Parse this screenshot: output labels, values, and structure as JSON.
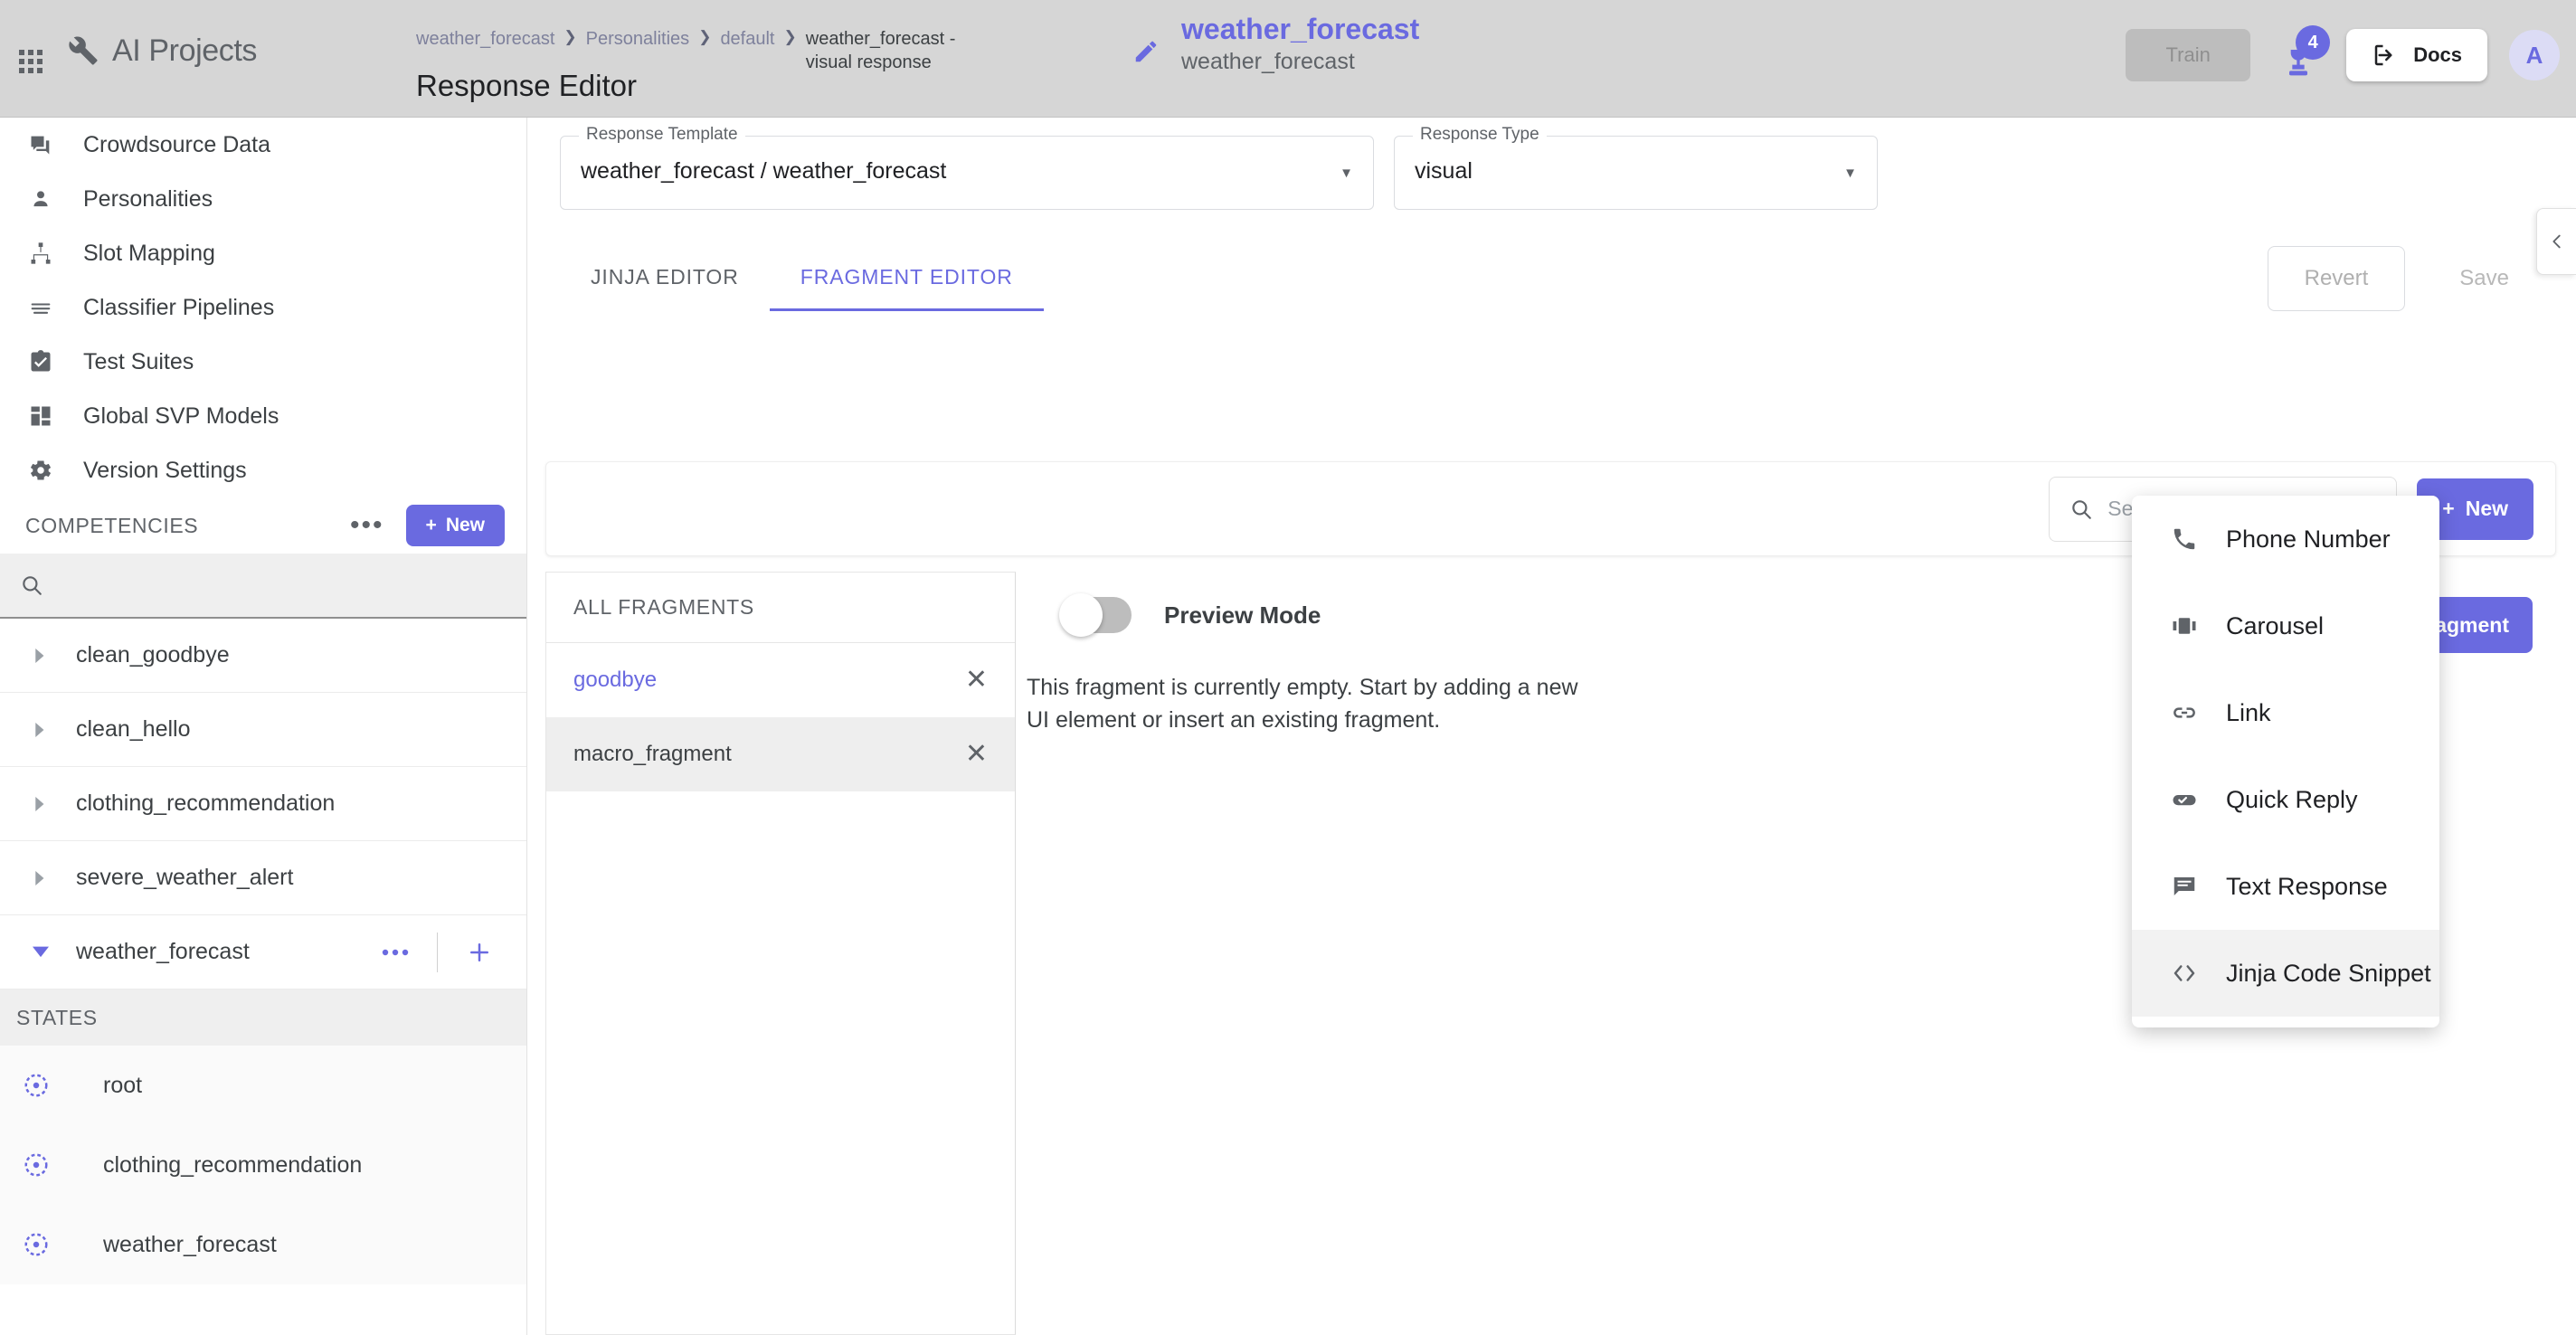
{
  "topbar": {
    "brand": "AI Projects",
    "brand_icon": "wrench-icon",
    "apps_icon": "apps-grid-icon",
    "breadcrumb": [
      "weather_forecast",
      "Personalities",
      "default"
    ],
    "breadcrumb_current": "weather_forecast - visual response",
    "page_title": "Response Editor",
    "entity_title": "weather_forecast",
    "entity_subtitle": "weather_forecast",
    "edit_icon": "pencil-icon",
    "train_label": "Train",
    "model_badge_count": "4",
    "model_icon": "model-trophy-icon",
    "docs_label": "Docs",
    "docs_icon": "export-arrow-icon",
    "avatar_initial": "A"
  },
  "sidebar": {
    "nav": [
      {
        "label": "Crowdsource Data",
        "icon": "forum-icon"
      },
      {
        "label": "Personalities",
        "icon": "person-icon"
      },
      {
        "label": "Slot Mapping",
        "icon": "account-tree-icon"
      },
      {
        "label": "Classifier Pipelines",
        "icon": "lines-icon"
      },
      {
        "label": "Test Suites",
        "icon": "clipboard-check-icon"
      },
      {
        "label": "Global SVP Models",
        "icon": "dashboard-icon"
      },
      {
        "label": "Version Settings",
        "icon": "gear-icon"
      }
    ],
    "competencies": {
      "title": "COMPETENCIES",
      "more_label": "•••",
      "new_label": "New",
      "search_value": "",
      "search_placeholder": "",
      "items": [
        {
          "label": "clean_goodbye",
          "expanded": false
        },
        {
          "label": "clean_hello",
          "expanded": false
        },
        {
          "label": "clothing_recommendation",
          "expanded": false
        },
        {
          "label": "severe_weather_alert",
          "expanded": false
        },
        {
          "label": "weather_forecast",
          "expanded": true
        }
      ]
    },
    "states": {
      "title": "STATES",
      "items": [
        {
          "label": "root"
        },
        {
          "label": "clothing_recommendation"
        },
        {
          "label": "weather_forecast"
        }
      ]
    }
  },
  "main": {
    "response_template": {
      "label": "Response Template",
      "value": "weather_forecast / weather_forecast"
    },
    "response_type": {
      "label": "Response Type",
      "value": "visual"
    },
    "tabs": [
      {
        "label": "JINJA EDITOR",
        "active": false
      },
      {
        "label": "FRAGMENT EDITOR",
        "active": true
      }
    ],
    "revert_label": "Revert",
    "save_label": "Save",
    "fragment_search": {
      "value": "",
      "placeholder": "Search fragments"
    },
    "new_fragment_label": "New",
    "all_fragments_title": "ALL FRAGMENTS",
    "fragments": [
      {
        "label": "goodbye",
        "selected": false
      },
      {
        "label": "macro_fragment",
        "selected": true
      }
    ],
    "preview_mode": {
      "label": "Preview Mode",
      "on": false
    },
    "empty_message": "This fragment is currently empty. Start by adding a new UI element or insert an existing fragment.",
    "add_fragment_label": "Add Fragment"
  },
  "menu": {
    "items": [
      {
        "label": "Phone Number",
        "icon": "phone-icon",
        "active": false
      },
      {
        "label": "Carousel",
        "icon": "carousel-icon",
        "active": false
      },
      {
        "label": "Link",
        "icon": "link-icon",
        "active": false
      },
      {
        "label": "Quick Reply",
        "icon": "quick-reply-icon",
        "active": false
      },
      {
        "label": "Text Response",
        "icon": "text-response-icon",
        "active": false
      },
      {
        "label": "Jinja Code Snippet",
        "icon": "code-icon",
        "active": true
      }
    ]
  },
  "colors": {
    "accent": "#6a6ae0",
    "topbar_bg": "#d6d6d6",
    "text": "#3c4043",
    "muted": "#5f6368"
  }
}
